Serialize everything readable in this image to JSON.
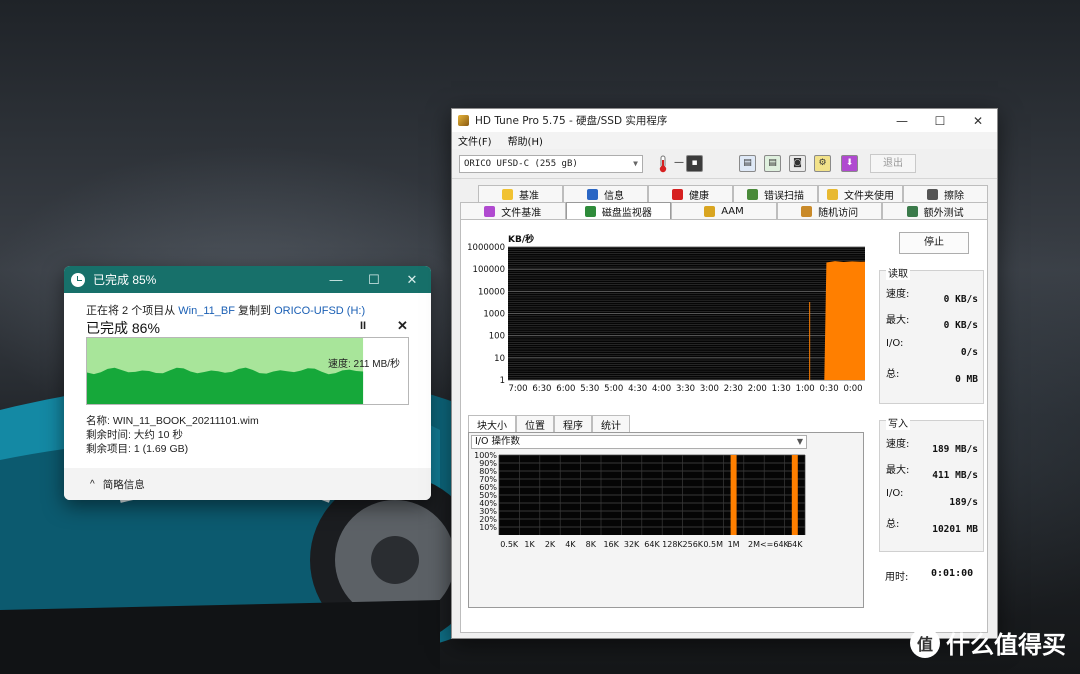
{
  "copy_dialog": {
    "title": "已完成 85%",
    "line_prefix": "正在将 2 个项目从 ",
    "source": "Win_11_BF",
    "line_middle": " 复制到 ",
    "destination": "ORICO-UFSD (H:)",
    "progress_text": "已完成 86%",
    "progress_percent": 86,
    "speed_label": "速度: 211 MB/秒",
    "name_label": "名称: WIN_11_BOOK_20211101.wim",
    "time_left": "剩余时间: 大约 10 秒",
    "items_left": "剩余项目: 1 (1.69 GB)",
    "less_details": "简略信息",
    "minimize": "—",
    "maximize": "☐",
    "close": "✕",
    "pause": "II",
    "stop": "✕",
    "colors": {
      "title_bar": "#17706a",
      "graph_fill": "#16a83a",
      "graph_bg": "#a8e59a"
    }
  },
  "hdtune": {
    "title": "HD Tune Pro 5.75 - 硬盘/SSD 实用程序",
    "menu": [
      "文件(F)",
      "帮助(H)"
    ],
    "drive": "ORICO   UFSD-C (255 gB)",
    "temperature": "—",
    "exit": "退出",
    "minimize": "—",
    "maximize": "☐",
    "close": "✕",
    "tabs_row1": [
      "基准",
      "信息",
      "健康",
      "错误扫描",
      "文件夹使用",
      "擦除"
    ],
    "tabs_row2": [
      "文件基准",
      "磁盘监视器",
      "AAM",
      "随机访问",
      "额外测试"
    ],
    "active_tab": "磁盘监视器",
    "stop_button": "停止",
    "read": {
      "header": "读取",
      "speed_label": "速度:",
      "speed": "0 KB/s",
      "max_label": "最大:",
      "max": "0 KB/s",
      "io_label": "I/O:",
      "io": "0/s",
      "total_label": "总:",
      "total": "0 MB"
    },
    "write": {
      "header": "写入",
      "speed_label": "速度:",
      "speed": "189 MB/s",
      "max_label": "最大:",
      "max": "411 MB/s",
      "io_label": "I/O:",
      "io": "189/s",
      "total_label": "总:",
      "total": "10201 MB"
    },
    "elapsed_label": "用时:",
    "elapsed": "0:01:00",
    "sub_tabs": [
      "块大小",
      "位置",
      "程序",
      "统计"
    ],
    "io_select": "I/O 操作数"
  },
  "chart_data": [
    {
      "type": "area",
      "unit_label": "KB/秒",
      "scale": "log",
      "y_ticks": [
        "1",
        "10",
        "100",
        "1000",
        "10000",
        "100000",
        "1000000"
      ],
      "x_ticks": [
        "7:00",
        "6:30",
        "6:00",
        "5:30",
        "5:00",
        "4:30",
        "4:00",
        "3:30",
        "3:00",
        "2:30",
        "2:00",
        "1:30",
        "1:00",
        "0:30",
        "0:00"
      ],
      "series": [
        {
          "color": "#ff7f00",
          "points": [
            [
              1.0,
              1
            ],
            [
              0.95,
              1
            ],
            [
              0.9,
              200000
            ],
            [
              0.7,
              230000
            ],
            [
              0.5,
              210000
            ],
            [
              0.3,
              225000
            ],
            [
              0.1,
              215000
            ],
            [
              0.0,
              220000
            ]
          ]
        }
      ]
    },
    {
      "type": "bar",
      "y_ticks": [
        "10%",
        "20%",
        "30%",
        "40%",
        "50%",
        "60%",
        "70%",
        "80%",
        "90%",
        "100%"
      ],
      "categories": [
        "0.5K",
        "1K",
        "2K",
        "4K",
        "8K",
        "16K",
        "32K",
        "64K",
        "128K",
        "256K",
        "0.5M",
        "1M",
        "2M",
        "<=64K",
        "64K"
      ],
      "values": [
        0,
        0,
        0,
        0,
        0,
        0,
        0,
        0,
        0,
        0,
        0,
        100,
        0,
        0,
        100
      ],
      "color": "#ff7f00"
    }
  ],
  "watermark": {
    "logo": "值",
    "text": "什么值得买"
  }
}
